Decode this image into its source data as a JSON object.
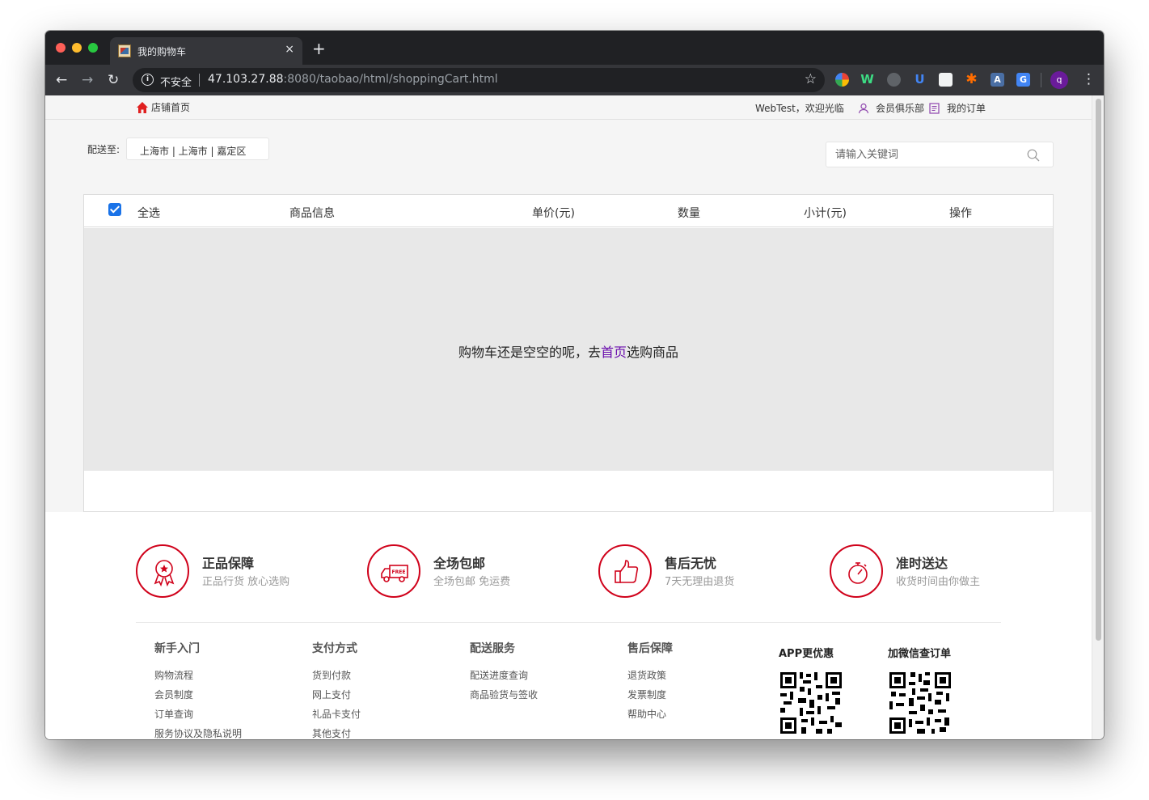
{
  "browser": {
    "tab_title": "我的购物车",
    "new_tab": "+",
    "tab_close": "×",
    "security_label": "不安全",
    "url_host": "47.103.27.88",
    "url_rest": ":8080/taobao/html/shoppingCart.html",
    "profile_initial": "q"
  },
  "topnav": {
    "home": "店铺首页",
    "welcome": "WebTest，欢迎光临",
    "club": "会员俱乐部",
    "orders": "我的订单"
  },
  "delivery": {
    "label": "配送至:",
    "address": "上海市 | 上海市 | 嘉定区"
  },
  "search": {
    "placeholder": "请输入关键词"
  },
  "cart": {
    "select_all_checked": true,
    "columns": {
      "select_all": "全选",
      "info": "商品信息",
      "price": "单价(元)",
      "qty": "数量",
      "subtotal": "小计(元)",
      "action": "操作"
    },
    "empty_prefix": "购物车还是空空的呢，去",
    "empty_link": "首页",
    "empty_suffix": "选购商品"
  },
  "features": [
    {
      "title": "正品保障",
      "subtitle": "正品行货 放心选购",
      "icon": "medal-icon"
    },
    {
      "title": "全场包邮",
      "subtitle": "全场包邮 免运费",
      "icon": "free-shipping-truck-icon"
    },
    {
      "title": "售后无忧",
      "subtitle": "7天无理由退货",
      "icon": "thumbs-up-icon"
    },
    {
      "title": "准时送达",
      "subtitle": "收货时间由你做主",
      "icon": "stopwatch-icon"
    }
  ],
  "truck_badge": "FREE",
  "footer_links": [
    {
      "head": "新手入门",
      "items": [
        "购物流程",
        "会员制度",
        "订单查询",
        "服务协议及隐私说明"
      ]
    },
    {
      "head": "支付方式",
      "items": [
        "货到付款",
        "网上支付",
        "礼品卡支付",
        "其他支付"
      ]
    },
    {
      "head": "配送服务",
      "items": [
        "配送进度查询",
        "商品验货与签收"
      ]
    },
    {
      "head": "售后保障",
      "items": [
        "退货政策",
        "发票制度",
        "帮助中心"
      ]
    }
  ],
  "qr": [
    {
      "title": "APP更优惠"
    },
    {
      "title": "加微信查订单"
    }
  ],
  "colors": {
    "accent_red": "#d0021b",
    "link_purple": "#6a0dad",
    "checkbox_blue": "#1a73e8"
  }
}
